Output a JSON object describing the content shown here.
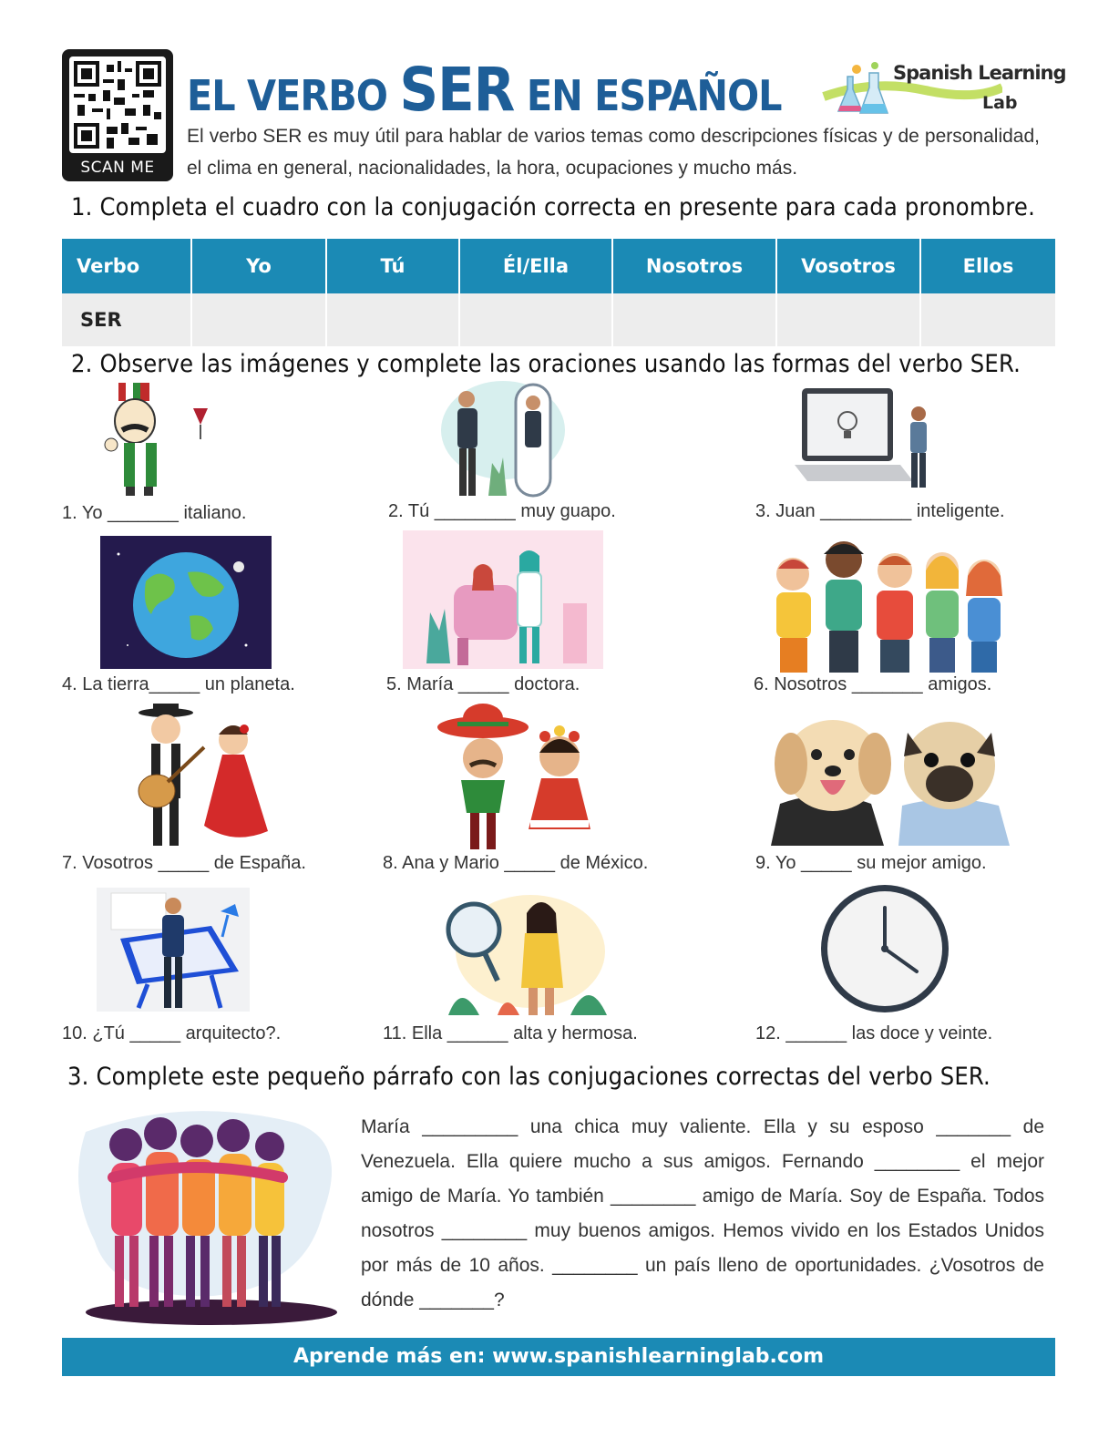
{
  "qr": {
    "label": "SCAN ME",
    "icon": "qr-code-icon"
  },
  "header": {
    "title_part1": "EL VERBO ",
    "title_big": "SER",
    "title_part2": " EN ESPAÑOL",
    "logo_line1": "Spanish Learning",
    "logo_line2": "Lab",
    "intro": "El verbo SER es muy útil para hablar de varios temas como descripciones físicas y de personalidad, el clima en general, nacionalidades, la hora, ocupaciones y mucho más."
  },
  "section1": {
    "title": "1. Completa el cuadro con la conjugación correcta en presente para cada pronombre.",
    "headers": [
      "Verbo",
      "Yo",
      "Tú",
      "Él/Ella",
      "Nosotros",
      "Vosotros",
      "Ellos"
    ],
    "row_label": "SER"
  },
  "section2": {
    "title": "2. Observe las imágenes y complete las oraciones usando las formas del verbo SER.",
    "items": [
      {
        "caption": "1. Yo _______ italiano.",
        "icon": "italian-waiter-icon"
      },
      {
        "caption": "2. Tú ________ muy guapo.",
        "icon": "man-mirror-icon"
      },
      {
        "caption": "3. Juan _________ inteligente.",
        "icon": "laptop-idea-icon"
      },
      {
        "caption": "4. La tierra_____ un planeta.",
        "icon": "earth-icon"
      },
      {
        "caption": "5. María _____ doctora.",
        "icon": "doctor-icon"
      },
      {
        "caption": "6. Nosotros _______ amigos.",
        "icon": "friends-group-icon"
      },
      {
        "caption": "7. Vosotros _____ de España.",
        "icon": "spanish-couple-icon"
      },
      {
        "caption": "8. Ana y Mario _____ de México.",
        "icon": "mexican-couple-icon"
      },
      {
        "caption": "9. Yo _____ su mejor amigo.",
        "icon": "dogs-icon"
      },
      {
        "caption": "10. ¿Tú _____ arquitecto?.",
        "icon": "architect-icon"
      },
      {
        "caption": "11. Ella ______ alta y hermosa.",
        "icon": "woman-magnifier-icon"
      },
      {
        "caption": "12. ______ las doce y veinte.",
        "icon": "clock-icon"
      }
    ]
  },
  "section3": {
    "title": "3. Complete este pequeño párrafo con las conjugaciones correctas del verbo SER.",
    "paragraph": "María _________ una chica muy valiente. Ella y su esposo _______ de Venezuela. Ella quiere mucho a sus amigos. Fernando ________ el mejor amigo de María. Yo también ________ amigo de María. Soy de España. Todos nosotros ________ muy buenos amigos. Hemos vivido en los Estados Unidos por más de 10 años. ________ un país lleno de oportunidades. ¿Vosotros de dónde _______?",
    "icon": "friends-hugging-icon"
  },
  "footer": {
    "text": "Aprende más en: www.spanishlearninglab.com"
  },
  "colors": {
    "title_blue": "#1e5e98",
    "accent_teal": "#1b8ab5",
    "cell_gray": "#ededed"
  }
}
